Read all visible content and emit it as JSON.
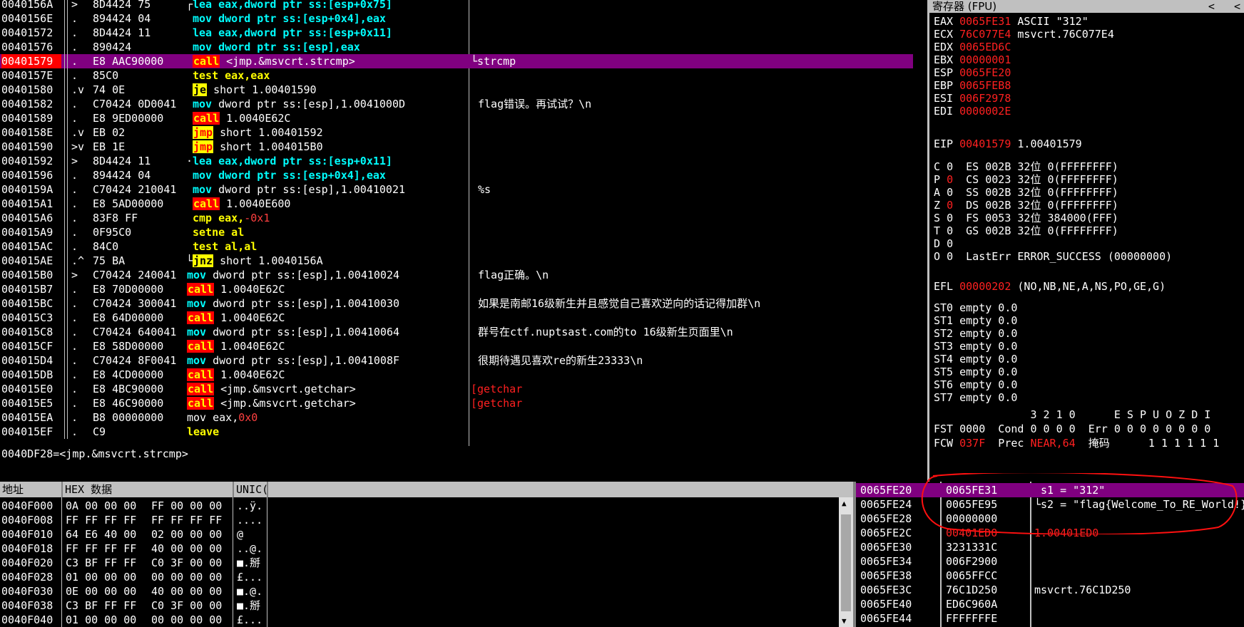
{
  "disasm": [
    {
      "addr": "0040156A",
      "mark": ">",
      "hex": "8D4424 75",
      "br": "┌",
      "ins": [
        [
          "mov",
          "lea"
        ],
        [
          "t",
          " eax,dword ptr ss:[esp+0x75]"
        ]
      ],
      "com": ""
    },
    {
      "addr": "0040156E",
      "mark": ".",
      "hex": "894424 04",
      "br": "",
      "ins": [
        [
          "mov",
          "mov"
        ],
        [
          "t",
          " dword ptr ss:[esp+0x4],eax"
        ]
      ],
      "com": ""
    },
    {
      "addr": "00401572",
      "mark": ".",
      "hex": "8D4424 11",
      "br": "",
      "ins": [
        [
          "mov",
          "lea"
        ],
        [
          "t",
          " eax,dword ptr ss:[esp+0x11]"
        ]
      ],
      "com": ""
    },
    {
      "addr": "00401576",
      "mark": ".",
      "hex": "890424",
      "br": "",
      "ins": [
        [
          "mov",
          "mov"
        ],
        [
          "t",
          " dword ptr ss:[esp],eax"
        ]
      ],
      "com": ""
    },
    {
      "addr": "00401579",
      "mark": ".",
      "hex": "E8 AAC90000",
      "br": "",
      "ins": [
        [
          "call",
          "call"
        ],
        [
          "w",
          " <jmp.&msvcrt.strcmp>"
        ]
      ],
      "com": "└strcmp",
      "sel": true,
      "addrRed": true
    },
    {
      "addr": "0040157E",
      "mark": ".",
      "hex": "85C0",
      "br": "",
      "ins": [
        [
          "other",
          "test"
        ],
        [
          "o",
          " eax,eax"
        ]
      ],
      "com": ""
    },
    {
      "addr": "00401580",
      "mark": ".v",
      "hex": "74 0E",
      "br": "",
      "ins": [
        [
          "jcc",
          "je"
        ],
        [
          "w",
          " short 1.00401590"
        ]
      ],
      "com": ""
    },
    {
      "addr": "00401582",
      "mark": ".",
      "hex": "C70424 0D0041",
      "br": "",
      "ins": [
        [
          "mov",
          "mov"
        ],
        [
          "w",
          " dword ptr ss:[esp],1.0041000D"
        ]
      ],
      "com": "flag错误。再试试？\\n"
    },
    {
      "addr": "00401589",
      "mark": ".",
      "hex": "E8 9ED00000",
      "br": "",
      "ins": [
        [
          "call",
          "call"
        ],
        [
          "w",
          " 1.0040E62C"
        ]
      ],
      "com": ""
    },
    {
      "addr": "0040158E",
      "mark": ".v",
      "hex": "EB 02",
      "br": "",
      "ins": [
        [
          "jmp",
          "jmp"
        ],
        [
          "w",
          " short 1.00401592"
        ]
      ],
      "com": ""
    },
    {
      "addr": "00401590",
      "mark": ">v",
      "hex": "EB 1E",
      "br": "",
      "ins": [
        [
          "jmp",
          "jmp"
        ],
        [
          "w",
          " short 1.004015B0"
        ]
      ],
      "com": ""
    },
    {
      "addr": "00401592",
      "mark": ">",
      "hex": "8D4424 11",
      "br": "·",
      "ins": [
        [
          "mov",
          "lea"
        ],
        [
          "t",
          " eax,dword ptr ss:[esp+0x11]"
        ]
      ],
      "com": ""
    },
    {
      "addr": "00401596",
      "mark": ".",
      "hex": "894424 04",
      "br": "",
      "ins": [
        [
          "mov",
          "mov"
        ],
        [
          "t",
          " dword ptr ss:[esp+0x4],eax"
        ]
      ],
      "com": ""
    },
    {
      "addr": "0040159A",
      "mark": ".",
      "hex": "C70424 210041",
      "br": "",
      "ins": [
        [
          "mov",
          "mov"
        ],
        [
          "w",
          " dword ptr ss:[esp],1.00410021"
        ]
      ],
      "com": "%s"
    },
    {
      "addr": "004015A1",
      "mark": ".",
      "hex": "E8 5AD00000",
      "br": "",
      "ins": [
        [
          "call",
          "call"
        ],
        [
          "w",
          " 1.0040E600"
        ]
      ],
      "com": ""
    },
    {
      "addr": "004015A6",
      "mark": ".",
      "hex": "83F8 FF",
      "br": "",
      "ins": [
        [
          "other",
          "cmp"
        ],
        [
          "o",
          " eax,"
        ],
        [
          "neg",
          "-0x1"
        ]
      ],
      "com": ""
    },
    {
      "addr": "004015A9",
      "mark": ".",
      "hex": "0F95C0",
      "br": "",
      "ins": [
        [
          "other",
          "setne"
        ],
        [
          "o",
          " al"
        ]
      ],
      "com": ""
    },
    {
      "addr": "004015AC",
      "mark": ".",
      "hex": "84C0",
      "br": "",
      "ins": [
        [
          "other",
          "test"
        ],
        [
          "o",
          " al,al"
        ]
      ],
      "com": ""
    },
    {
      "addr": "004015AE",
      "mark": ".^",
      "hex": "75 BA",
      "br": "└",
      "ins": [
        [
          "jcc",
          "jnz"
        ],
        [
          "w",
          " short 1.0040156A"
        ]
      ],
      "com": ""
    },
    {
      "addr": "004015B0",
      "mark": ">",
      "hex": "C70424 240041",
      "br": "",
      "ins": [
        [
          "mov",
          "mov"
        ],
        [
          "w",
          " dword ptr ss:[esp],1.00410024"
        ]
      ],
      "com": "flag正确。\\n",
      "outdent": true
    },
    {
      "addr": "004015B7",
      "mark": ".",
      "hex": "E8 70D00000",
      "br": "",
      "ins": [
        [
          "call",
          "call"
        ],
        [
          "w",
          " 1.0040E62C"
        ]
      ],
      "com": "",
      "outdent": true
    },
    {
      "addr": "004015BC",
      "mark": ".",
      "hex": "C70424 300041",
      "br": "",
      "ins": [
        [
          "mov",
          "mov"
        ],
        [
          "w",
          " dword ptr ss:[esp],1.00410030"
        ]
      ],
      "com": "如果是南邮16级新生并且感觉自己喜欢逆向的话记得加群\\n",
      "outdent": true
    },
    {
      "addr": "004015C3",
      "mark": ".",
      "hex": "E8 64D00000",
      "br": "",
      "ins": [
        [
          "call",
          "call"
        ],
        [
          "w",
          " 1.0040E62C"
        ]
      ],
      "com": "",
      "outdent": true
    },
    {
      "addr": "004015C8",
      "mark": ".",
      "hex": "C70424 640041",
      "br": "",
      "ins": [
        [
          "mov",
          "mov"
        ],
        [
          "w",
          " dword ptr ss:[esp],1.00410064"
        ]
      ],
      "com": "群号在ctf.nuptsast.com的to 16级新生页面里\\n",
      "outdent": true
    },
    {
      "addr": "004015CF",
      "mark": ".",
      "hex": "E8 58D00000",
      "br": "",
      "ins": [
        [
          "call",
          "call"
        ],
        [
          "w",
          " 1.0040E62C"
        ]
      ],
      "com": "",
      "outdent": true
    },
    {
      "addr": "004015D4",
      "mark": ".",
      "hex": "C70424 8F0041",
      "br": "",
      "ins": [
        [
          "mov",
          "mov"
        ],
        [
          "w",
          " dword ptr ss:[esp],1.0041008F"
        ]
      ],
      "com": "很期待遇见喜欢re的新生23333\\n",
      "outdent": true
    },
    {
      "addr": "004015DB",
      "mark": ".",
      "hex": "E8 4CD00000",
      "br": "",
      "ins": [
        [
          "call",
          "call"
        ],
        [
          "w",
          " 1.0040E62C"
        ]
      ],
      "com": "",
      "outdent": true
    },
    {
      "addr": "004015E0",
      "mark": ".",
      "hex": "E8 4BC90000",
      "br": "",
      "ins": [
        [
          "call",
          "call"
        ],
        [
          "w",
          " <jmp.&msvcrt.getchar>"
        ]
      ],
      "com": "[getchar",
      "comRed": true,
      "outdent": true
    },
    {
      "addr": "004015E5",
      "mark": ".",
      "hex": "E8 46C90000",
      "br": "",
      "ins": [
        [
          "call",
          "call"
        ],
        [
          "w",
          " <jmp.&msvcrt.getchar>"
        ]
      ],
      "com": "[getchar",
      "comRed": true,
      "outdent": true
    },
    {
      "addr": "004015EA",
      "mark": ".",
      "hex": "B8 00000000",
      "br": "",
      "ins": [
        [
          "w",
          "mov"
        ],
        [
          "w",
          " eax,"
        ],
        [
          "neg",
          "0x0"
        ]
      ],
      "com": "",
      "outdent": true
    },
    {
      "addr": "004015EF",
      "mark": ".",
      "hex": "C9",
      "br": "",
      "ins": [
        [
          "other",
          "leave"
        ]
      ],
      "com": "",
      "outdent": true
    }
  ],
  "info_line": "0040DF28=<jmp.&msvcrt.strcmp>",
  "registers": {
    "title": "寄存器 (FPU)",
    "nav": "<   <",
    "gprs": [
      {
        "name": "EAX",
        "val": "0065FE31",
        "com": "ASCII \"312\""
      },
      {
        "name": "ECX",
        "val": "76C077E4",
        "com": "msvcrt.76C077E4"
      },
      {
        "name": "EDX",
        "val": "0065ED6C",
        "com": ""
      },
      {
        "name": "EBX",
        "val": "00000001",
        "com": ""
      },
      {
        "name": "ESP",
        "val": "0065FE20",
        "com": ""
      },
      {
        "name": "EBP",
        "val": "0065FEB8",
        "com": ""
      },
      {
        "name": "ESI",
        "val": "006F2978",
        "com": ""
      },
      {
        "name": "EDI",
        "val": "0000002E",
        "com": ""
      }
    ],
    "eip": {
      "name": "EIP",
      "val": "00401579",
      "com": "1.00401579"
    },
    "flags": [
      {
        "f": "C",
        "v": "0",
        "red": false,
        "seg": "ES 002B 32位 0(FFFFFFFF)"
      },
      {
        "f": "P",
        "v": "0",
        "red": true,
        "seg": "CS 0023 32位 0(FFFFFFFF)"
      },
      {
        "f": "A",
        "v": "0",
        "red": false,
        "seg": "SS 002B 32位 0(FFFFFFFF)"
      },
      {
        "f": "Z",
        "v": "0",
        "red": true,
        "seg": "DS 002B 32位 0(FFFFFFFF)"
      },
      {
        "f": "S",
        "v": "0",
        "red": false,
        "seg": "FS 0053 32位 384000(FFF)"
      },
      {
        "f": "T",
        "v": "0",
        "red": false,
        "seg": "GS 002B 32位 0(FFFFFFFF)"
      },
      {
        "f": "D",
        "v": "0",
        "red": false,
        "seg": ""
      },
      {
        "f": "O",
        "v": "0",
        "red": false,
        "seg": "LastErr ERROR_SUCCESS (00000000)"
      }
    ],
    "efl": {
      "name": "EFL",
      "val": "00000202",
      "com": "(NO,NB,NE,A,NS,PO,GE,G)"
    },
    "fpu": [
      "ST0 empty 0.0",
      "ST1 empty 0.0",
      "ST2 empty 0.0",
      "ST3 empty 0.0",
      "ST4 empty 0.0",
      "ST5 empty 0.0",
      "ST6 empty 0.0",
      "ST7 empty 0.0"
    ],
    "fpu_hdr": "               3 2 1 0      E S P U O Z D I",
    "fst": "FST 0000  Cond 0 0 0 0  Err 0 0 0 0 0 0 0 0",
    "fcw_a": "FCW ",
    "fcw_val": "037F",
    "fcw_b": "  Prec ",
    "fcw_prec": "NEAR,64",
    "fcw_c": "  掩码      1 1 1 1 1 1"
  },
  "dump": {
    "headers": [
      "地址",
      "HEX 数据",
      "UNIC("
    ],
    "rows": [
      [
        "0040F000",
        "0A 00 00 00",
        "FF 00 00 00",
        "..ÿ."
      ],
      [
        "0040F008",
        "FF FF FF FF",
        "FF FF FF FF",
        "...."
      ],
      [
        "0040F010",
        "64 E6 40 00",
        "02 00 00 00",
        "@ "
      ],
      [
        "0040F018",
        "FF FF FF FF",
        "40 00 00 00",
        "..@."
      ],
      [
        "0040F020",
        "C3 BF FF FF",
        "C0 3F 00 00",
        "■.掰"
      ],
      [
        "0040F028",
        "01 00 00 00",
        "00 00 00 00",
        "£..."
      ],
      [
        "0040F030",
        "0E 00 00 00",
        "40 00 00 00",
        "■.@."
      ],
      [
        "0040F038",
        "C3 BF FF FF",
        "C0 3F 00 00",
        "■.掰"
      ],
      [
        "0040F040",
        "01 00 00 00",
        "00 00 00 00",
        "£..."
      ]
    ]
  },
  "stack": [
    {
      "addr": "0065FE20",
      "val": "0065FE31",
      "com": " s1 = \"312\"",
      "sel": true
    },
    {
      "addr": "0065FE24",
      "val": "0065FE95",
      "com": "└s2 = \"flag{Welcome_To_RE_World!}\""
    },
    {
      "addr": "0065FE28",
      "val": "00000000",
      "com": ""
    },
    {
      "addr": "0065FE2C",
      "val": "00401ED0",
      "com": "1.00401ED0",
      "red": true
    },
    {
      "addr": "0065FE30",
      "val": "3231331C",
      "com": ""
    },
    {
      "addr": "0065FE34",
      "val": "006F2900",
      "com": ""
    },
    {
      "addr": "0065FE38",
      "val": "0065FFCC",
      "com": ""
    },
    {
      "addr": "0065FE3C",
      "val": "76C1D250",
      "com": "msvcrt.76C1D250"
    },
    {
      "addr": "0065FE40",
      "val": "ED6C960A",
      "com": ""
    },
    {
      "addr": "0065FE44",
      "val": "FFFFFFFE",
      "com": ""
    }
  ],
  "colors": {
    "highlight": "#800080",
    "call_bg": "#ff0000",
    "jmp_bg": "#ffff00",
    "mov_fg": "#00ffff",
    "red": "#ff2020",
    "annotation": "#ff0000"
  }
}
